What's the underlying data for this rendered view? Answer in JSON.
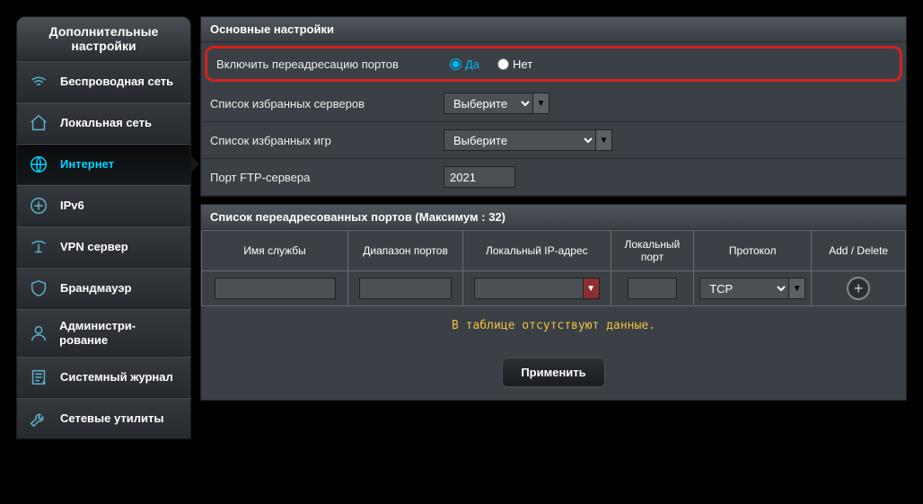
{
  "sidebar": {
    "title": "Дополнительные настройки",
    "items": [
      {
        "label": "Беспроводная сеть"
      },
      {
        "label": "Локальная сеть"
      },
      {
        "label": "Интернет"
      },
      {
        "label": "IPv6"
      },
      {
        "label": "VPN сервер"
      },
      {
        "label": "Брандмауэр"
      },
      {
        "label": "Администри-рование"
      },
      {
        "label": "Системный журнал"
      },
      {
        "label": "Сетевые утилиты"
      }
    ]
  },
  "main": {
    "basic_header": "Основные настройки",
    "enable_row": {
      "label": "Включить переадресацию портов",
      "yes": "Да",
      "no": "Нет"
    },
    "favorite_servers": {
      "label": "Список избранных серверов",
      "placeholder": "Выберите"
    },
    "favorite_games": {
      "label": "Список избранных игр",
      "placeholder": "Выберите"
    },
    "ftp_port": {
      "label": "Порт FTP-сервера",
      "value": "2021"
    },
    "table_header": "Список переадресованных портов (Максимум : 32)",
    "columns": {
      "service": "Имя службы",
      "range": "Диапазон портов",
      "local_ip": "Локальный IP-адрес",
      "local_port": "Локальный порт",
      "protocol": "Протокол",
      "actions": "Add / Delete"
    },
    "protocol_value": "TCP",
    "empty_msg": "В таблице отсутствуют данные.",
    "apply": "Применить"
  }
}
